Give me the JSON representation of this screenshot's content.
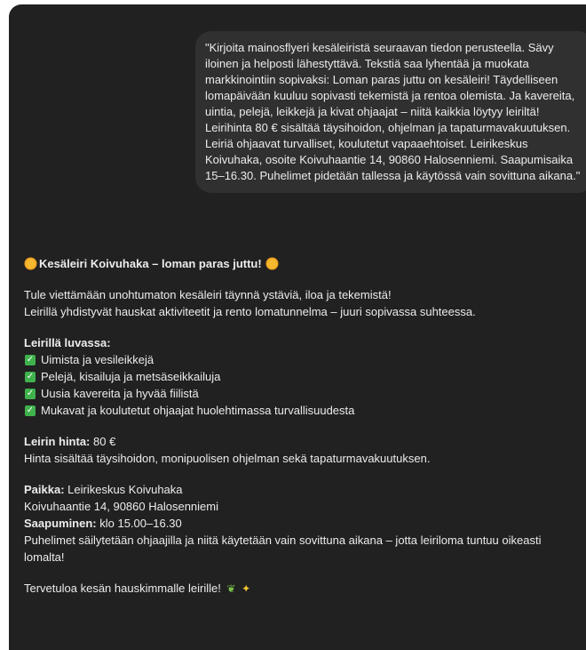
{
  "user_message": {
    "text": "\"Kirjoita mainosflyeri kesäleiristä seuraavan tiedon perusteella. Sävy iloinen ja helposti lähestyttävä. Tekstiä saa lyhentää ja muokata markkinointiin sopivaksi: Loman paras juttu on kesäleiri! Täydelliseen lomapäivään kuuluu sopivasti tekemistä ja rentoa olemista. Ja kavereita, uintia, pelejä, leikkejä ja kivat ohjaajat – niitä kaikkia löytyy leiriltä! Leirihinta 80 € sisältää täysihoidon, ohjelman ja tapaturmavakuutuksen. Leiriä ohjaavat turvalliset, koulutetut vapaaehtoiset. Leirikeskus Koivuhaka, osoite Koivuhaantie 14, 90860 Halosenniemi. Saapumisaika 15–16.30. Puhelimet pidetään tallessa ja käytössä vain sovittuna aikana.\""
  },
  "assistant_message": {
    "title": "Kesäleiri Koivuhaka – loman paras juttu!",
    "intro_line1": "Tule viettämään unohtumaton kesäleiri täynnä ystäviä, iloa ja tekemistä!",
    "intro_line2": "Leirillä yhdistyvät hauskat aktiviteetit ja rento lomatunnelma – juuri sopivassa suhteessa.",
    "list_heading": "Leirillä luvassa:",
    "list_items": [
      "Uimista ja vesileikkejä",
      "Pelejä, kisailuja ja metsäseikkailuja",
      "Uusia kavereita ja hyvää fiilistä",
      "Mukavat ja koulutetut ohjaajat huolehtimassa turvallisuudesta"
    ],
    "price_label": "Leirin hinta:",
    "price_value": " 80 €",
    "price_desc": "Hinta sisältää täysihoidon, monipuolisen ohjelman sekä tapaturmavakuutuksen.",
    "place_label": "Paikka:",
    "place_value": " Leirikeskus Koivuhaka",
    "address": "Koivuhaantie 14, 90860 Halosenniemi",
    "arrival_label": "Saapuminen:",
    "arrival_value": " klo 15.00–16.30",
    "phones": "Puhelimet säilytetään ohjaajilla ja niitä käytetään vain sovittuna aikana – jotta leiriloma tuntuu oikeasti lomalta!",
    "closing": "Tervetuloa kesän hauskimmalle leirille!",
    "icons": {
      "title_emoji": "sun-icon",
      "check_emoji": "check-mark-button-icon",
      "closing_emojis": [
        "herb-icon",
        "sparkles-icon"
      ]
    }
  },
  "colors": {
    "background": "#212121",
    "user_bubble": "#303030",
    "text": "#ececec",
    "check_green": "#40b24d"
  }
}
